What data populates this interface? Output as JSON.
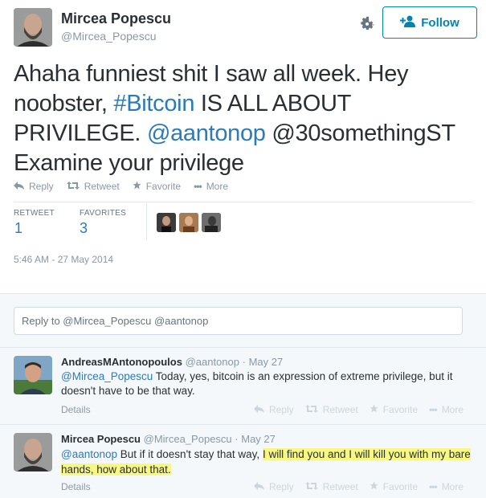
{
  "main_tweet": {
    "author_name": "Mircea Popescu",
    "author_handle": "@Mircea_Popescu",
    "follow_label": "Follow",
    "text_parts": [
      {
        "t": "Ahaha funniest shit I saw all week. Hey noobster, ",
        "link": false
      },
      {
        "t": "#Bitcoin",
        "link": true
      },
      {
        "t": " IS ALL ABOUT PRIVILEGE. ",
        "link": false
      },
      {
        "t": "@aantonop",
        "link": true
      },
      {
        "t": " @30somethingST Examine your privilege",
        "link": false
      }
    ],
    "actions": {
      "reply": "Reply",
      "retweet": "Retweet",
      "favorite": "Favorite",
      "more": "More"
    },
    "stats": {
      "retweet_label": "RETWEET",
      "retweet_count": "1",
      "favorites_label": "FAVORITES",
      "favorites_count": "3"
    },
    "timestamp": "5:46 AM - 27 May 2014"
  },
  "reply_box": {
    "placeholder": "Reply to @Mircea_Popescu @aantonop"
  },
  "replies": [
    {
      "name": "AndreasMAntonopoulos",
      "handle": "@aantonop",
      "sep": "·",
      "time": "May 27",
      "mention": "@Mircea_Popescu",
      "text": " Today, yes, bitcoin is an expression of extreme privilege, but it doesn't have to be that way.",
      "details": "Details",
      "actions": {
        "reply": "Reply",
        "retweet": "Retweet",
        "favorite": "Favorite",
        "more": "More"
      }
    },
    {
      "name": "Mircea Popescu",
      "handle": "@Mircea_Popescu",
      "sep": "·",
      "time": "May 27",
      "mention": "@aantonop",
      "text": " But if it doesn't stay that way, ",
      "highlight": "I will find you and I will kill you with my bare hands, how about that.",
      "details": "Details",
      "actions": {
        "reply": "Reply",
        "retweet": "Retweet",
        "favorite": "Favorite",
        "more": "More"
      }
    }
  ],
  "colors": {
    "link": "#2b7bb9",
    "follow": "#0084b4",
    "highlight": "#f7f783",
    "muted": "#8899a6"
  }
}
